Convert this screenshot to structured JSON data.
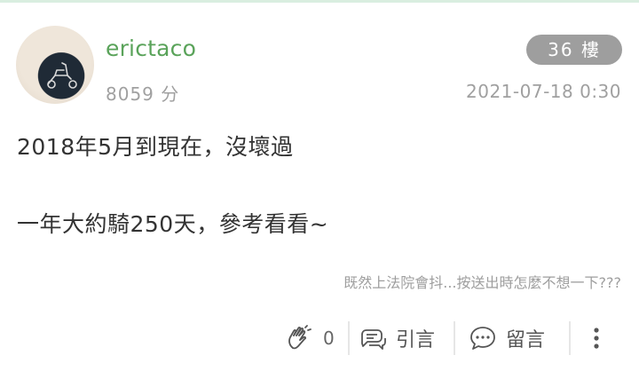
{
  "post": {
    "author": "erictaco",
    "score": "8059 分",
    "floor": "36 樓",
    "timestamp": "2021-07-18 0:30",
    "content_lines": [
      "2018年5月到現在，沒壞過",
      "一年大約騎250天，參考看看~"
    ],
    "signature": "既然上法院會抖...按送出時怎麼不想一下???"
  },
  "actions": {
    "like_count": "0",
    "quote_label": "引言",
    "comment_label": "留言"
  },
  "icons": {
    "like": "clap-hands-icon",
    "quote": "quote-bubbles-icon",
    "comment": "comment-bubble-icon",
    "more": "more-vertical-icon",
    "avatar": "scooter-avatar"
  },
  "colors": {
    "username": "#5aa35a",
    "badge_bg": "#9e9e9e",
    "meta_text": "#a0a0a0",
    "body_text": "#333333"
  }
}
